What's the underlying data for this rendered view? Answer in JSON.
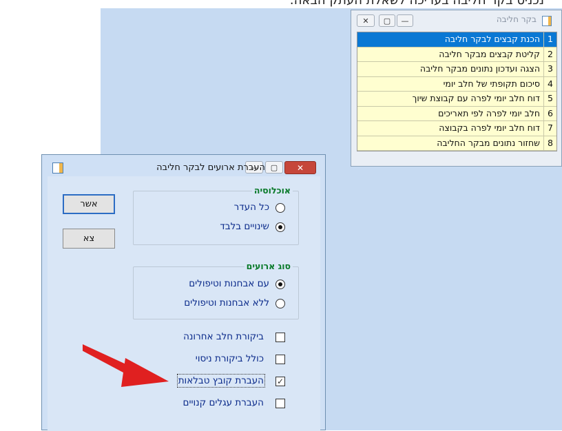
{
  "top_caption": "נכניס בקר חליבה בעריכה לשאלת העתק הבאה:",
  "menu_window": {
    "title": "בקר חליבה",
    "buttons": {
      "close": "✕",
      "maximize": "▢",
      "minimize": "—"
    },
    "items": [
      {
        "num": "1",
        "label": "הכנת קבצים לבקר חליבה",
        "selected": true
      },
      {
        "num": "2",
        "label": "קליטת קבצים מבקר חליבה"
      },
      {
        "num": "3",
        "label": "הצגה ועדכון נתונים מבקר חליבה"
      },
      {
        "num": "4",
        "label": "סיכום תקופתי של חלב יומי"
      },
      {
        "num": "5",
        "label": "דוח חלב יומי לפרה עם קבוצת שיוך"
      },
      {
        "num": "6",
        "label": "חלב יומי לפרה לפי תאריכים"
      },
      {
        "num": "7",
        "label": "דוח חלב יומי לפרה בקבוצה"
      },
      {
        "num": "8",
        "label": "שחזור נתונים מבקר החליבה"
      }
    ]
  },
  "dialog": {
    "title": "העברת ארועים לבקר חליבה",
    "buttons": {
      "close": "✕",
      "maximize": "▢",
      "minimize": "—"
    },
    "confirm_label": "אשר",
    "exit_label": "צא",
    "population": {
      "legend": "אוכלוסיה",
      "options": [
        {
          "label": "כל העדר",
          "checked": false
        },
        {
          "label": "שינויים בלבד",
          "checked": true
        }
      ]
    },
    "event_type": {
      "legend": "סוג ארועים",
      "options": [
        {
          "label": "עם אבחנות וטיפולים",
          "checked": true
        },
        {
          "label": "ללא אבחנות וטיפולים",
          "checked": false
        }
      ]
    },
    "checkboxes": [
      {
        "label": "ביקורת חלב אחרונה",
        "checked": false
      },
      {
        "label": "כולל ביקורת ניסוי",
        "checked": false
      },
      {
        "label": "העברת קובץ טבלאות",
        "checked": true
      },
      {
        "label": "העברת עגלים קנויים",
        "checked": false
      }
    ]
  },
  "colors": {
    "background": "#c6daf2",
    "menu_selected": "#0a78d4",
    "menu_bg": "#fffed0",
    "legend_green": "#0a7a2a",
    "label_blue": "#0a2a8a",
    "arrow_red": "#e02020"
  },
  "icons": [
    "app-icon",
    "close-icon",
    "maximize-icon",
    "minimize-icon",
    "radio-icon",
    "checkbox-icon",
    "check-icon",
    "red-arrow-icon"
  ]
}
